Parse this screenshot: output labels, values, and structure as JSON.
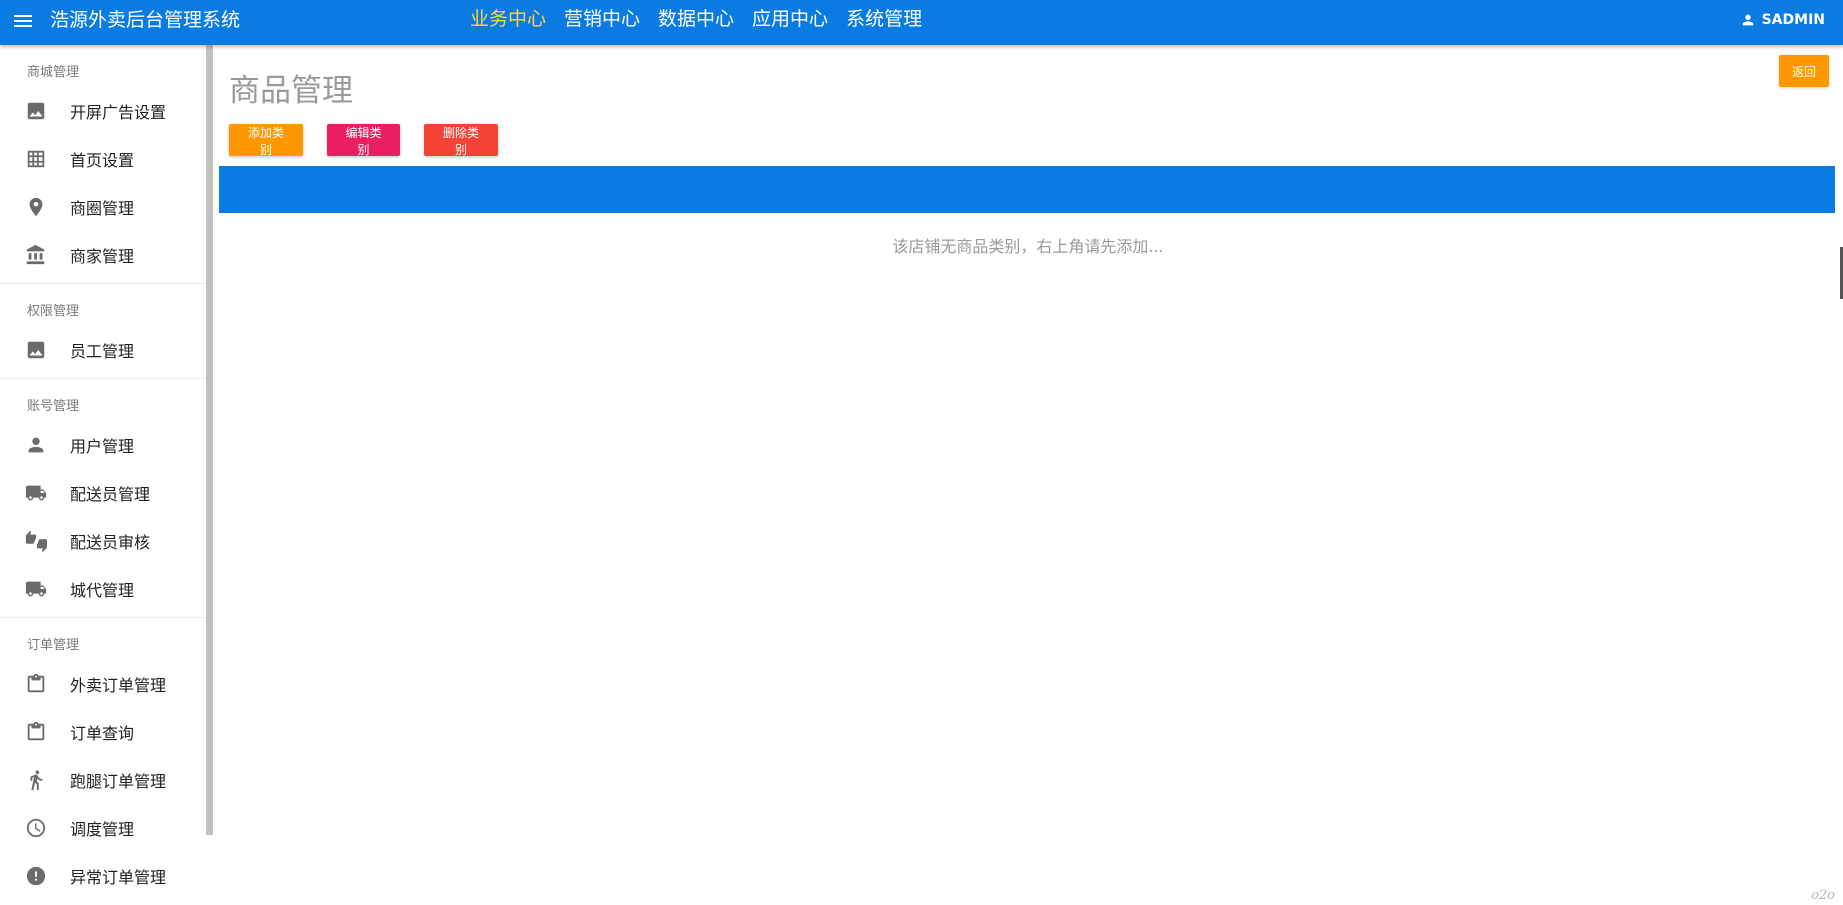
{
  "header": {
    "app_title": "浩源外卖后台管理系统",
    "nav": [
      "业务中心",
      "营销中心",
      "数据中心",
      "应用中心",
      "系统管理"
    ],
    "active_nav": "业务中心",
    "user": "SADMIN"
  },
  "sidebar": {
    "sections": [
      {
        "title": "商城管理",
        "items": [
          {
            "label": "开屏广告设置",
            "icon": "image-icon"
          },
          {
            "label": "首页设置",
            "icon": "grid-icon"
          },
          {
            "label": "商圈管理",
            "icon": "location-pin-icon"
          },
          {
            "label": "商家管理",
            "icon": "bank-icon"
          }
        ]
      },
      {
        "title": "权限管理",
        "items": [
          {
            "label": "员工管理",
            "icon": "image-icon"
          }
        ]
      },
      {
        "title": "账号管理",
        "items": [
          {
            "label": "用户管理",
            "icon": "person-icon"
          },
          {
            "label": "配送员管理",
            "icon": "truck-icon"
          },
          {
            "label": "配送员审核",
            "icon": "thumbs-icon"
          },
          {
            "label": "城代管理",
            "icon": "truck-icon"
          }
        ]
      },
      {
        "title": "订单管理",
        "items": [
          {
            "label": "外卖订单管理",
            "icon": "clipboard-icon"
          },
          {
            "label": "订单查询",
            "icon": "clipboard-icon"
          },
          {
            "label": "跑腿订单管理",
            "icon": "runner-icon"
          },
          {
            "label": "调度管理",
            "icon": "clock-icon"
          },
          {
            "label": "异常订单管理",
            "icon": "alert-icon"
          }
        ]
      }
    ]
  },
  "main": {
    "title": "商品管理",
    "back_label": "返回",
    "add_label": "添加类别",
    "edit_label": "编辑类别",
    "delete_label": "删除类别",
    "empty_message": "该店铺无商品类别，右上角请先添加...",
    "watermark": "o2o"
  },
  "colors": {
    "primary": "#0a7be2",
    "active_nav": "#ffd640",
    "orange": "#ff9800",
    "pink": "#e91e63",
    "red": "#f44336"
  }
}
